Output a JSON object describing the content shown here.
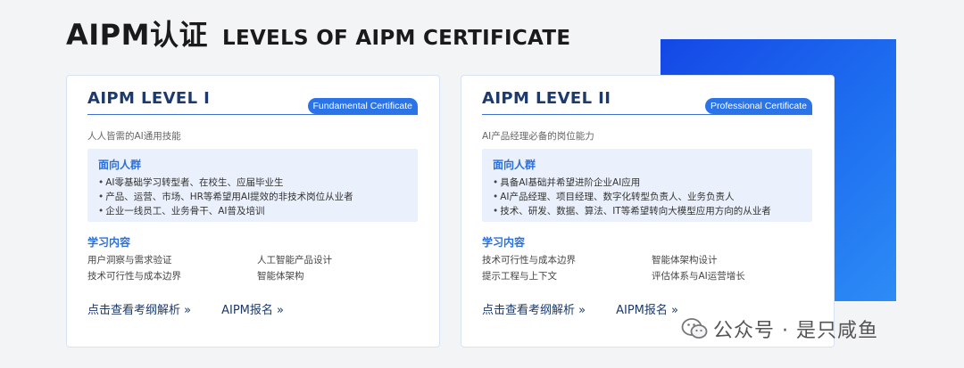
{
  "header": {
    "title_cn": "AIPM认证",
    "title_en": "LEVELS OF AIPM CERTIFICATE"
  },
  "cards": [
    {
      "title": "AIPM LEVEL I",
      "badge": "Fundamental Certificate",
      "subtitle": "人人皆需的AI通用技能",
      "audience_title": "面向人群",
      "audience": [
        "AI零基础学习转型者、在校生、应届毕业生",
        "产品、运营、市场、HR等希望用AI提效的非技术岗位从业者",
        "企业一线员工、业务骨干、AI普及培训"
      ],
      "learn_title": "学习内容",
      "learn": [
        "用户洞察与需求验证",
        "人工智能产品设计",
        "技术可行性与成本边界",
        "智能体架构"
      ],
      "link1": "点击查看考纲解析 »",
      "link2": "AIPM报名 »"
    },
    {
      "title": "AIPM LEVEL II",
      "badge": "Professional Certificate",
      "subtitle": "AI产品经理必备的岗位能力",
      "audience_title": "面向人群",
      "audience": [
        "具备AI基础并希望进阶企业AI应用",
        "AI产品经理、项目经理、数字化转型负责人、业务负责人",
        "技术、研发、数据、算法、IT等希望转向大模型应用方向的从业者"
      ],
      "learn_title": "学习内容",
      "learn": [
        "技术可行性与成本边界",
        "智能体架构设计",
        "提示工程与上下文",
        "评估体系与AI运营增长"
      ],
      "link1": "点击查看考纲解析 »",
      "link2": "AIPM报名 »"
    }
  ],
  "watermark": {
    "text": "公众号 · 是只咸鱼",
    "icon": "wechat-icon"
  },
  "colors": {
    "accent": "#2b74e8",
    "title_navy": "#1c3a6b",
    "blue_block": "#1e6ff0"
  }
}
